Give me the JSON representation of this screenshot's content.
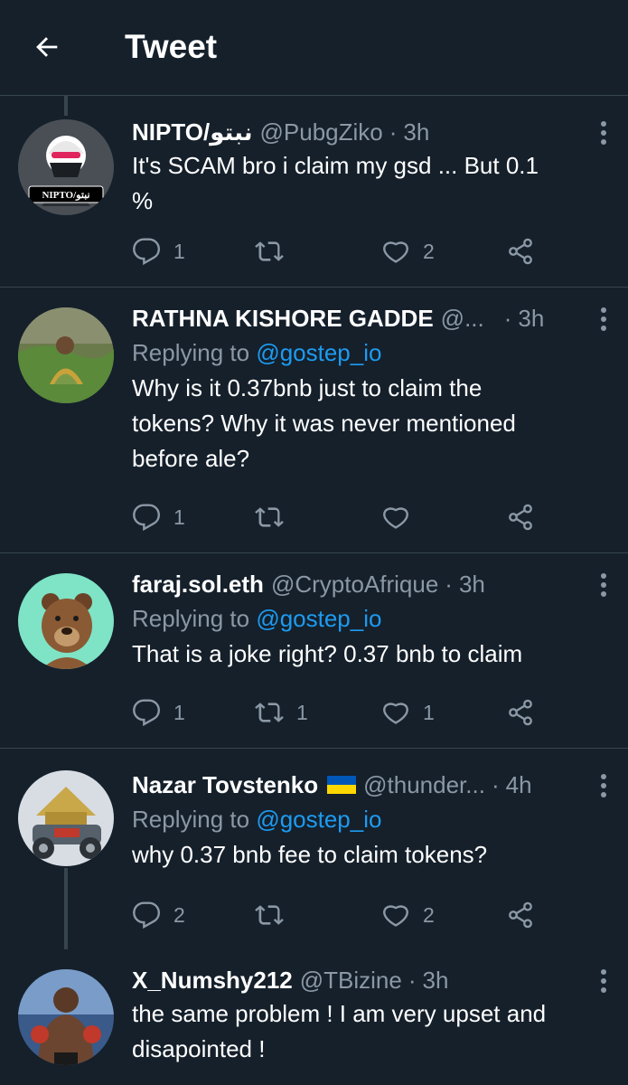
{
  "header": {
    "title": "Tweet"
  },
  "tweets": [
    {
      "name": "NIPTO/نبتو",
      "handle": "@PubgZiko",
      "time": "3h",
      "reply_prefix": "",
      "reply_mention": "",
      "body_line1": "It's SCAM bro i claim my gsd ... But 0.1",
      "body_line2": "%",
      "body_line3": "",
      "avatar_badge": "NIPTO/نبتو",
      "reply_count": "1",
      "retweet_count": "",
      "like_count": "2"
    },
    {
      "name": "RATHNA KISHORE GADDE",
      "handle": "@...",
      "time": "3h",
      "reply_prefix": "Replying to",
      "reply_mention": "@gostep_io",
      "body_line1": "Why is it 0.37bnb just to claim the",
      "body_line2": "tokens? Why it was never mentioned",
      "body_line3": "before ale?",
      "reply_count": "1",
      "retweet_count": "",
      "like_count": ""
    },
    {
      "name": "faraj.sol.eth",
      "handle": "@CryptoAfrique",
      "time": "3h",
      "reply_prefix": "Replying to",
      "reply_mention": "@gostep_io",
      "body_line1": "That is a joke right? 0.37 bnb to claim",
      "reply_count": "1",
      "retweet_count": "1",
      "like_count": "1"
    },
    {
      "name": "Nazar Tovstenko",
      "handle": "@thunder...",
      "time": "4h",
      "reply_prefix": "Replying to",
      "reply_mention": "@gostep_io",
      "body_line1": "why 0.37 bnb fee to claim tokens?",
      "reply_count": "2",
      "retweet_count": "",
      "like_count": "2",
      "flag_colors": [
        "#0057b7",
        "#ffd700"
      ]
    },
    {
      "name": "X_Numshy212",
      "handle": "@TBizine",
      "time": "3h",
      "body_line1": "the same problem ! I am very upset and",
      "body_line2": "disapointed !"
    }
  ],
  "colors": {
    "background": "#15202b",
    "divider": "#38444d",
    "secondary_text": "#8b98a5",
    "accent": "#1d9bf0"
  },
  "icons": [
    "back-arrow-icon",
    "more-vertical-icon",
    "reply-icon",
    "retweet-icon",
    "like-icon",
    "share-icon"
  ]
}
